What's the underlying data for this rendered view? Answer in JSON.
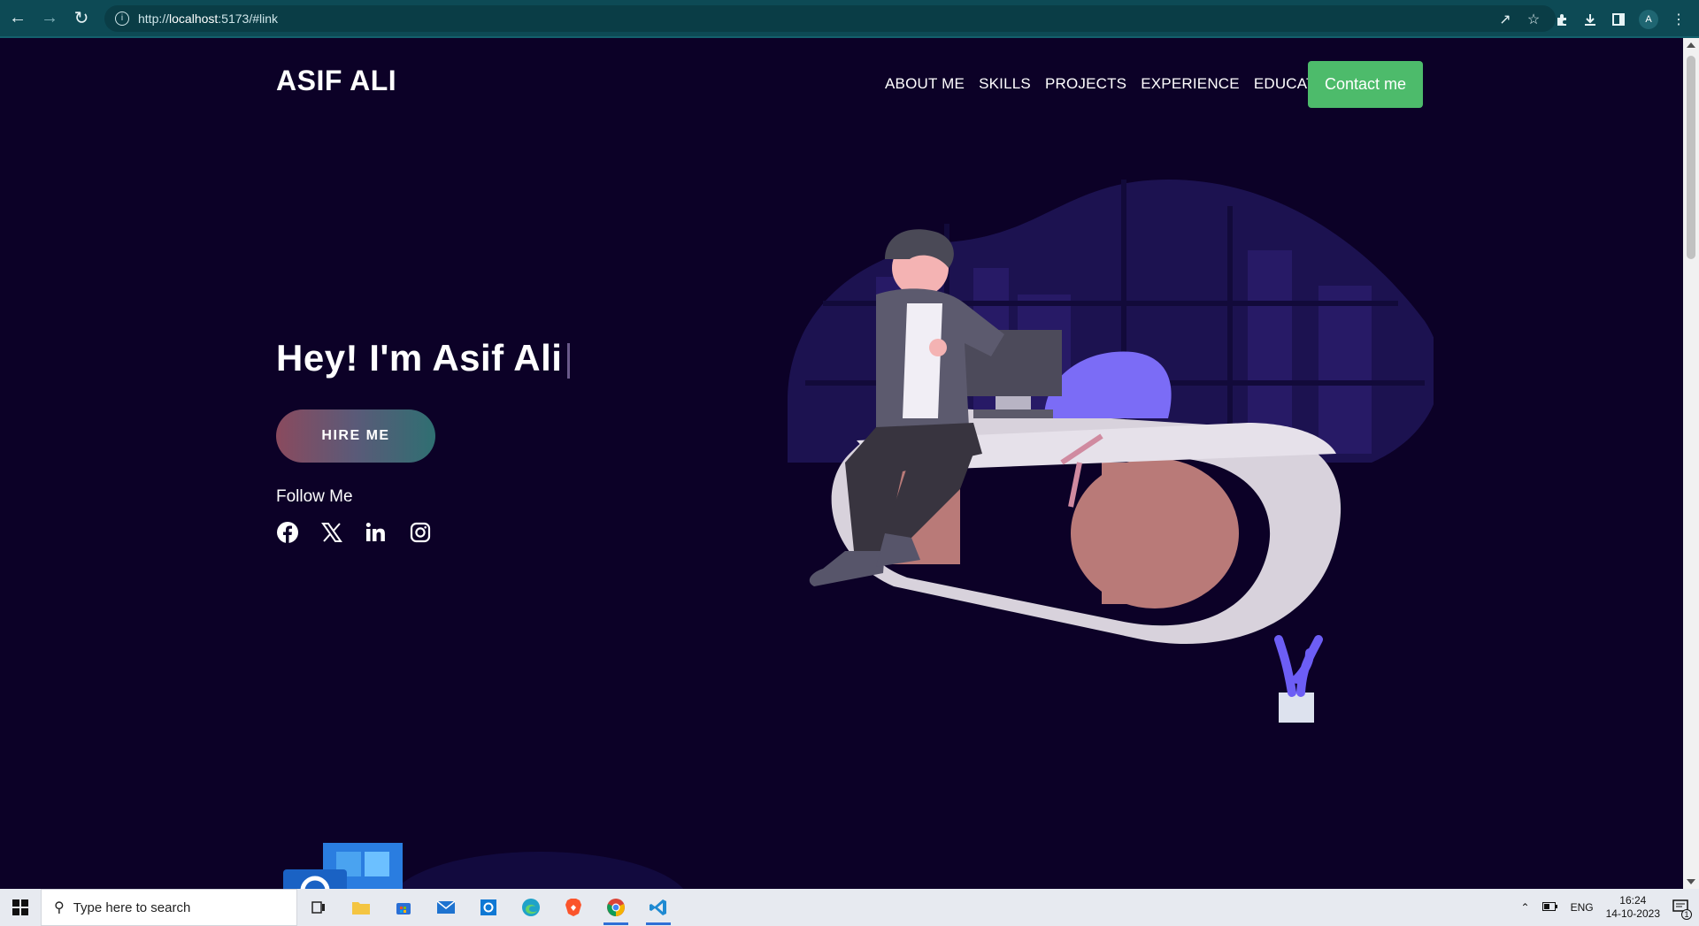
{
  "browser": {
    "url_prefix": "http://",
    "url_host": "localhost",
    "url_rest": ":5173/#link",
    "profile_initial": "A"
  },
  "site": {
    "brand": "ASIF ALI",
    "nav": [
      "ABOUT ME",
      "SKILLS",
      "PROJECTS",
      "EXPERIENCE",
      "EDUCATION"
    ],
    "contact_label": "Contact me",
    "hero_title": "Hey! I'm Asif Ali",
    "hire_label": "HIRE ME",
    "follow_label": "Follow Me",
    "socials": [
      "facebook-icon",
      "x-icon",
      "linkedin-icon",
      "instagram-icon"
    ]
  },
  "taskbar": {
    "search_placeholder": "Type here to search",
    "language": "ENG",
    "time": "16:24",
    "date": "14-10-2023",
    "notification_count": "1"
  },
  "colors": {
    "page_bg": "#0c0127",
    "contact_green": "#4dbb6b",
    "chrome_teal": "#0d4a55"
  }
}
